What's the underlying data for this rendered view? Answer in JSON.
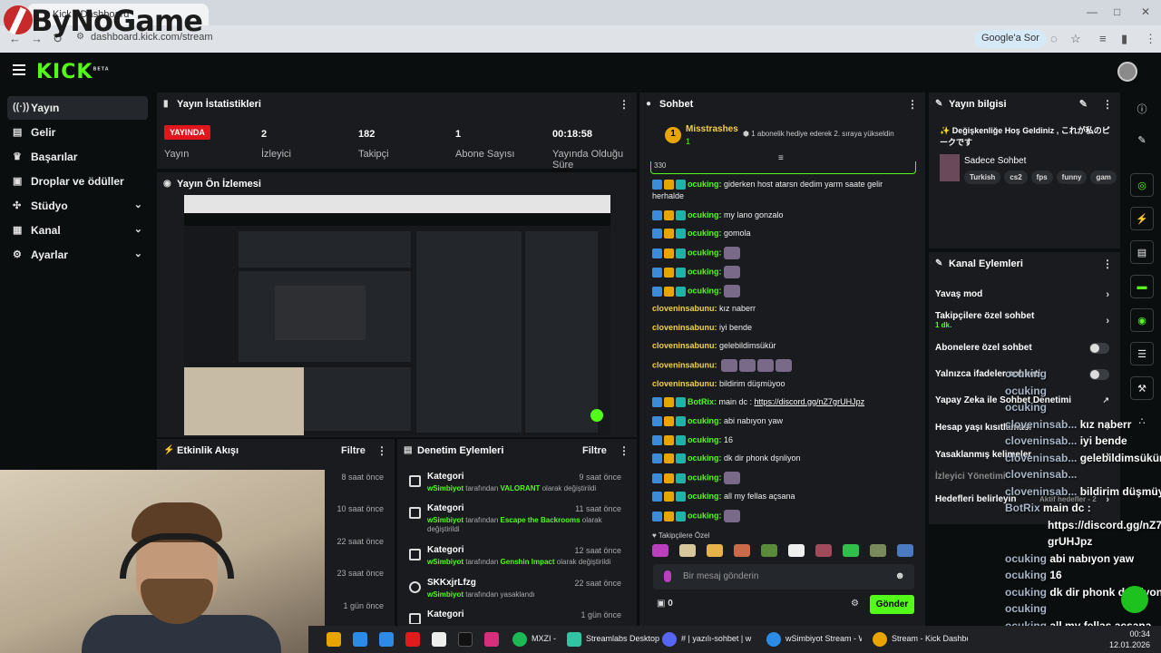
{
  "browser": {
    "tab_title": "Kick - Dashboard",
    "url": "dashboard.kick.com/stream",
    "google_button": "Google'a Sor",
    "watermark": "ByNoGame"
  },
  "kick": {
    "logo": "KICK",
    "beta": "BETA"
  },
  "sidebar": {
    "items": [
      {
        "label": "Yayın",
        "icon": "broadcast-icon"
      },
      {
        "label": "Gelir",
        "icon": "revenue-icon"
      },
      {
        "label": "Başarılar",
        "icon": "trophy-icon"
      },
      {
        "label": "Droplar ve ödüller",
        "icon": "drops-icon"
      },
      {
        "label": "Stüdyo",
        "icon": "studio-icon"
      },
      {
        "label": "Kanal",
        "icon": "channel-icon"
      },
      {
        "label": "Ayarlar",
        "icon": "gear-icon"
      }
    ]
  },
  "stats": {
    "title": "Yayın İstatistikleri",
    "live_badge": "YAYINDA",
    "broadcast_label": "Yayın",
    "viewers_value": "2",
    "viewers_label": "İzleyici",
    "followers_value": "182",
    "followers_label": "Takipçi",
    "subs_value": "1",
    "subs_label": "Abone Sayısı",
    "uptime_value": "00:18:58",
    "uptime_label": "Yayında Olduğu Süre"
  },
  "preview": {
    "title": "Yayın Ön İzlemesi"
  },
  "activity": {
    "title": "Etkinlik Akışı",
    "filter": "Filtre",
    "times": [
      "8 saat önce",
      "10 saat önce",
      "22 saat önce",
      "23 saat önce",
      "1 gün önce"
    ]
  },
  "moderation": {
    "title": "Denetim Eylemleri",
    "filter": "Filtre",
    "rows": [
      {
        "title": "Kategori",
        "time": "9 saat önce",
        "user": "wSimbiyot",
        "pre": "tarafından",
        "target": "VALORANT",
        "post": "olarak değiştirildi"
      },
      {
        "title": "Kategori",
        "time": "11 saat önce",
        "user": "wSimbiyot",
        "pre": "tarafından",
        "target": "Escape the Backrooms",
        "post": "olarak değiştirildi"
      },
      {
        "title": "Kategori",
        "time": "12 saat önce",
        "user": "wSimbiyot",
        "pre": "tarafından",
        "target": "Genshin Impact",
        "post": "olarak değiştirildi"
      },
      {
        "title": "SKKxjrLfzg",
        "time": "22 saat önce",
        "user": "wSimbiyot",
        "pre": "tarafından yasaklandı",
        "target": "",
        "post": ""
      },
      {
        "title": "Kategori",
        "time": "1 gün önce",
        "user": "",
        "pre": "",
        "target": "",
        "post": ""
      }
    ]
  },
  "chat": {
    "title": "Sohbet",
    "pinned_user": "Misstrashes",
    "pinned_rank": "1",
    "pinned_level": "1",
    "pinned_text": "1 abonelik hediye ederek 2. sıraya yükseldin",
    "top_fragment": "330",
    "messages": [
      {
        "user": "ocuking",
        "text": "giderken host atarsn dedim yarm saate gelir herhalde",
        "badges": true
      },
      {
        "user": "ocuking",
        "text": "my lano gonzalo",
        "badges": true
      },
      {
        "user": "ocuking",
        "text": "gomola",
        "badges": true
      },
      {
        "user": "ocuking",
        "text": "",
        "badges": true,
        "emote": true
      },
      {
        "user": "ocuking",
        "text": "",
        "badges": true,
        "emote": true
      },
      {
        "user": "ocuking",
        "text": "",
        "badges": true,
        "emote": true
      },
      {
        "user": "cloveninsabunu",
        "text": "kız naberr",
        "badges": false
      },
      {
        "user": "cloveninsabunu",
        "text": "iyi bende",
        "badges": false
      },
      {
        "user": "cloveninsabunu",
        "text": "gelebildimsükür",
        "badges": false
      },
      {
        "user": "cloveninsabunu",
        "text": "",
        "badges": false,
        "emotes4": true
      },
      {
        "user": "cloveninsabunu",
        "text": "bildirim düşmüyoo",
        "badges": false
      },
      {
        "user": "BotRix",
        "text": "main dc : ",
        "link": "https://discord.gg/nZ7grUHJpz",
        "badges": true
      },
      {
        "user": "ocuking",
        "text": "abi nabıyon yaw",
        "badges": true
      },
      {
        "user": "ocuking",
        "text": "16",
        "badges": true
      },
      {
        "user": "ocuking",
        "text": "dk dir phonk dşnliyon",
        "badges": true
      },
      {
        "user": "ocuking",
        "text": "",
        "badges": true,
        "emote": true
      },
      {
        "user": "ocuking",
        "text": "all my fellas açsana",
        "badges": true
      },
      {
        "user": "ocuking",
        "text": "",
        "badges": true,
        "emote": true
      }
    ],
    "followers_only_label": "Takipçilere Özel",
    "input_placeholder": "Bir mesaj gönderin",
    "points": "0",
    "send_label": "Gönder"
  },
  "stream_info": {
    "title": "Yayın bilgisi",
    "stream_title": "✨ Değişkenliğe Hoş Geldiniz , これが私のピークです",
    "category": "Sadece Sohbet",
    "tags": [
      "Turkish",
      "cs2",
      "fps",
      "funny",
      "gam"
    ]
  },
  "channel_actions": {
    "title": "Kanal Eylemleri",
    "items": [
      {
        "label": "Yavaş mod",
        "kind": "arrow"
      },
      {
        "label": "Takipçilere özel sohbet",
        "sub": "1 dk.",
        "kind": "arrow"
      },
      {
        "label": "Abonelere özel sohbet",
        "kind": "toggle"
      },
      {
        "label": "Yalnızca ifadeler sohbeti",
        "kind": "toggle"
      },
      {
        "label": "Yapay Zeka ile Sohbet Denetimi",
        "kind": "external"
      },
      {
        "label": "Hesap yaşı kısıtlaması",
        "kind": "arrow"
      },
      {
        "label": "Yasaklanmış kelimeler",
        "kind": "arrow"
      },
      {
        "label": "İzleyici Yönetimi",
        "kind": "none"
      },
      {
        "label": "Hedefleri belirleyin",
        "sub": "Aktif hedefler - 2",
        "kind": "arrow"
      }
    ]
  },
  "overlay_chat": [
    {
      "user": "ocuking",
      "text": ""
    },
    {
      "user": "ocuking",
      "text": ""
    },
    {
      "user": "ocuking",
      "text": ""
    },
    {
      "user": "cloveninsab...",
      "text": "kız naberr"
    },
    {
      "user": "cloveninsab...",
      "text": "iyi bende"
    },
    {
      "user": "cloveninsab...",
      "text": "gelebildimsükür"
    },
    {
      "user": "cloveninsab...",
      "text": ""
    },
    {
      "user": "cloveninsab...",
      "text": "bildirim düşmüyoo"
    },
    {
      "user": "BotRix",
      "text": "main dc :"
    },
    {
      "user": "",
      "text": "https://discord.gg/nZ7"
    },
    {
      "user": "",
      "text": "grUHJpz"
    },
    {
      "user": "ocuking",
      "text": "abi nabıyon yaw"
    },
    {
      "user": "ocuking",
      "text": "16"
    },
    {
      "user": "ocuking",
      "text": "dk dir phonk dşnliyon"
    },
    {
      "user": "ocuking",
      "text": ""
    },
    {
      "user": "ocuking",
      "text": "all my fellas açsana"
    },
    {
      "user": "ocuking",
      "text": ""
    }
  ],
  "taskbar": {
    "apps": [
      "MXZI -",
      "Streamlabs Desktop",
      "# | yazılı-sohbet | w",
      "wSimbiyot Stream - Wi",
      "Stream - Kick Dashboa"
    ],
    "time": "00:34",
    "date": "12.01.2026"
  },
  "colors": {
    "kick_green": "#53fc18",
    "live_red": "#e1161d",
    "panel_bg": "#191b1f",
    "page_bg": "#0b0e0f"
  }
}
